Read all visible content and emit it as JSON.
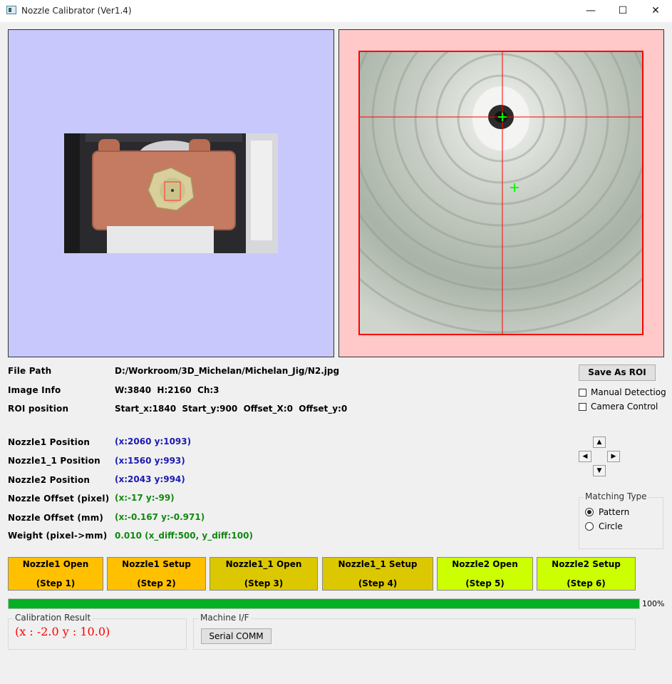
{
  "window": {
    "title": "Nozzle Calibrator (Ver1.4)",
    "controls": {
      "minimize": "—",
      "maximize": "☐",
      "close": "✕"
    }
  },
  "colors": {
    "left_panel_bg": "#c8c8fc",
    "right_panel_bg": "#ffc9c9",
    "roi_border": "#ff0000",
    "crosshair": "#ff0000",
    "marker": "#00ff00",
    "progress": "#06b025",
    "btn_orange": "#ffc000",
    "btn_olive": "#dcc800",
    "btn_lime": "#ccff00",
    "result_red": "#ff0000"
  },
  "info": {
    "file_path_label": "File Path",
    "file_path_value": "D:/Workroom/3D_Michelan/Michelan_Jig/N2.jpg",
    "image_info_label": "Image Info",
    "image_info_value": "W:3840  H:2160  Ch:3",
    "roi_label": "ROI position",
    "roi_value": "Start_x:1840  Start_y:900  Offset_X:0  Offset_y:0"
  },
  "positions": {
    "nozzle1_label": "Nozzle1 Position",
    "nozzle1_value": "(x:2060 y:1093)",
    "nozzle1_1_label": "Nozzle1_1 Position",
    "nozzle1_1_value": "(x:1560 y:993)",
    "nozzle2_label": "Nozzle2 Position",
    "nozzle2_value": "(x:2043 y:994)",
    "offset_px_label": "Nozzle Offset (pixel)",
    "offset_px_value": "(x:-17 y:-99)",
    "offset_mm_label": "Nozzle Offset (mm)",
    "offset_mm_value": "(x:-0.167 y:-0.971)",
    "weight_label": "Weight (pixel->mm)",
    "weight_value": "0.010 (x_diff:500, y_diff:100)"
  },
  "controls": {
    "save_roi": "Save As ROI",
    "manual_detect": "Manual Detectiog",
    "manual_detect_checked": false,
    "camera_control": "Camera Control",
    "camera_control_checked": false,
    "arrows": {
      "up": "▲",
      "left": "◀",
      "right": "▶",
      "down": "▼"
    }
  },
  "matching": {
    "title": "Matching Type",
    "pattern": "Pattern",
    "circle": "Circle",
    "selected": "Pattern"
  },
  "steps": [
    {
      "title": "Nozzle1 Open",
      "step": "(Step 1)"
    },
    {
      "title": "Nozzle1 Setup",
      "step": "(Step 2)"
    },
    {
      "title": "Nozzle1_1 Open",
      "step": "(Step 3)"
    },
    {
      "title": "Nozzle1_1 Setup",
      "step": "(Step 4)"
    },
    {
      "title": "Nozzle2 Open",
      "step": "(Step 5)"
    },
    {
      "title": "Nozzle2 Setup",
      "step": "(Step 6)"
    }
  ],
  "progress": {
    "value": 1.0,
    "label": "100%"
  },
  "calibration": {
    "title": "Calibration Result",
    "value": "(x : -2.0 y : 10.0)"
  },
  "machine": {
    "title": "Machine I/F",
    "serial_button": "Serial COMM"
  }
}
